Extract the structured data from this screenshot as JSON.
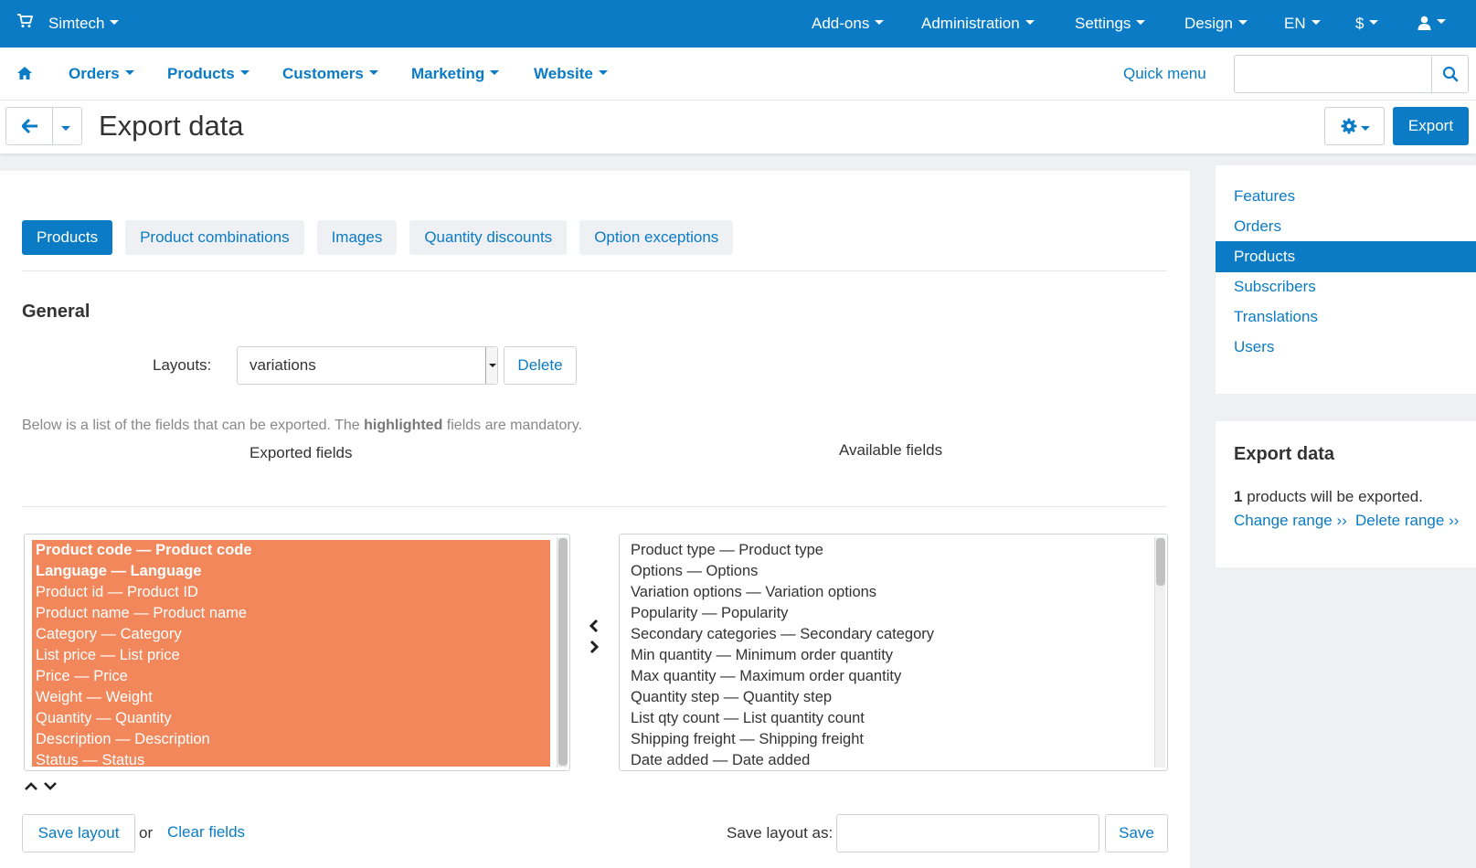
{
  "topbar": {
    "brand": "Simtech",
    "menu": [
      "Add-ons",
      "Administration",
      "Settings",
      "Design",
      "EN",
      "$"
    ]
  },
  "mainnav": {
    "items": [
      "Orders",
      "Products",
      "Customers",
      "Marketing",
      "Website"
    ],
    "quick_menu": "Quick menu",
    "search_placeholder": ""
  },
  "titlebar": {
    "title": "Export data",
    "export_label": "Export"
  },
  "tabs": [
    "Products",
    "Product combinations",
    "Images",
    "Quantity discounts",
    "Option exceptions"
  ],
  "general": {
    "heading": "General",
    "layouts_label": "Layouts:",
    "layout_selected": "variations",
    "delete_label": "Delete",
    "note_prefix": "Below is a list of the fields that can be exported. The ",
    "note_bold": "highlighted",
    "note_suffix": " fields are mandatory."
  },
  "fields": {
    "exported_heading": "Exported fields",
    "available_heading": "Available fields",
    "exported": [
      "Product code — Product code",
      "Language — Language",
      "Product id — Product ID",
      "Product name — Product name",
      "Category — Category",
      "List price — List price",
      "Price — Price",
      "Weight — Weight",
      "Quantity — Quantity",
      "Description — Description",
      "Status — Status"
    ],
    "available": [
      "Product type — Product type",
      "Options — Options",
      "Variation options — Variation options",
      "Popularity — Popularity",
      "Secondary categories — Secondary category",
      "Min quantity — Minimum order quantity",
      "Max quantity — Maximum order quantity",
      "Quantity step — Quantity step",
      "List qty count — List quantity count",
      "Shipping freight — Shipping freight",
      "Date added — Date added"
    ]
  },
  "footer": {
    "save_layout_label": "Save layout",
    "or_label": "or",
    "clear_fields_label": "Clear fields",
    "save_layout_as_label": "Save layout as:",
    "save_label": "Save"
  },
  "sidebar": {
    "items": [
      "Features",
      "Orders",
      "Products",
      "Subscribers",
      "Translations",
      "Users"
    ],
    "active_item": "Products",
    "export_title": "Export data",
    "count": "1",
    "count_suffix": " products will be exported.",
    "change_range": "Change range ››",
    "delete_range": "Delete range ››"
  },
  "colors": {
    "primary": "#0a7bc4",
    "highlight": "#f1875a",
    "background": "#eef0f3"
  }
}
